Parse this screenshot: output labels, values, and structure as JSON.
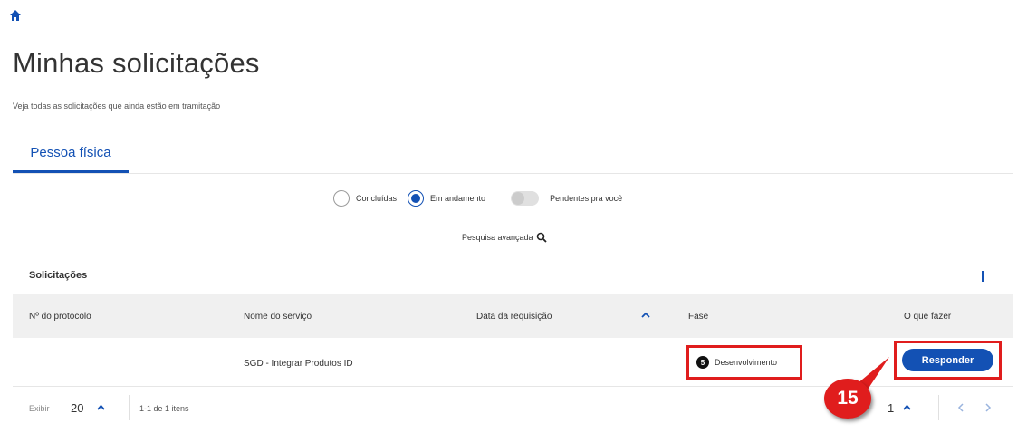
{
  "page": {
    "title": "Minhas solicitações",
    "subtitle": "Veja todas as solicitações que ainda estão em tramitação"
  },
  "tabs": [
    {
      "label": "Pessoa física",
      "active": true
    }
  ],
  "filters": {
    "concluded": {
      "label": "Concluídas",
      "checked": false
    },
    "in_progress": {
      "label": "Em andamento",
      "checked": true
    },
    "pending": {
      "label": "Pendentes pra você",
      "on": false
    }
  },
  "advanced_search": {
    "label": "Pesquisa avançada",
    "icon": "search-icon"
  },
  "section": {
    "title": "Solicitações"
  },
  "table": {
    "columns": [
      "Nº do protocolo",
      "Nome do serviço",
      "Data da requisição",
      "Fase",
      "O que fazer"
    ],
    "rows": [
      {
        "protocol": "",
        "service": "SGD - Integrar Produtos ID",
        "date": "",
        "phase_number": "5",
        "phase_label": "Desenvolvimento",
        "action_label": "Responder"
      }
    ]
  },
  "footer": {
    "show_label": "Exibir",
    "page_size": "20",
    "range": "1-1 de 1 itens",
    "current_page": "1"
  },
  "annotation": {
    "step": "15"
  },
  "colors": {
    "primary": "#1351b4",
    "highlight": "#e01d1d",
    "header_bg": "#f0f0f0"
  }
}
